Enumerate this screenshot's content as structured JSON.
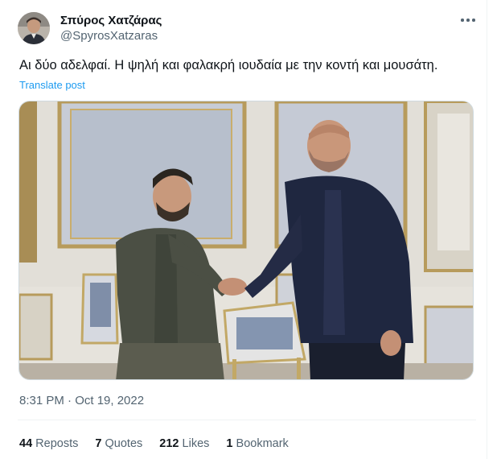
{
  "author": {
    "display_name": "Σπύρος Χατζάρας",
    "handle": "@SpyrosXatzaras"
  },
  "tweet": {
    "text": "Αι δύο αδελφαί. Η ψηλή και φαλακρή ιουδαία με την κοντή και μουσάτη.",
    "translate_label": "Translate post",
    "timestamp": "8:31 PM · Oct 19, 2022"
  },
  "stats": {
    "reposts_count": "44",
    "reposts_label": "Reposts",
    "quotes_count": "7",
    "quotes_label": "Quotes",
    "likes_count": "212",
    "likes_label": "Likes",
    "bookmarks_count": "1",
    "bookmarks_label": "Bookmark"
  },
  "icons": {
    "more": "more-horizontal-icon"
  },
  "colors": {
    "link": "#1d9bf0",
    "secondary_text": "#536471",
    "primary_text": "#0f1419",
    "border": "#cfd9de"
  }
}
